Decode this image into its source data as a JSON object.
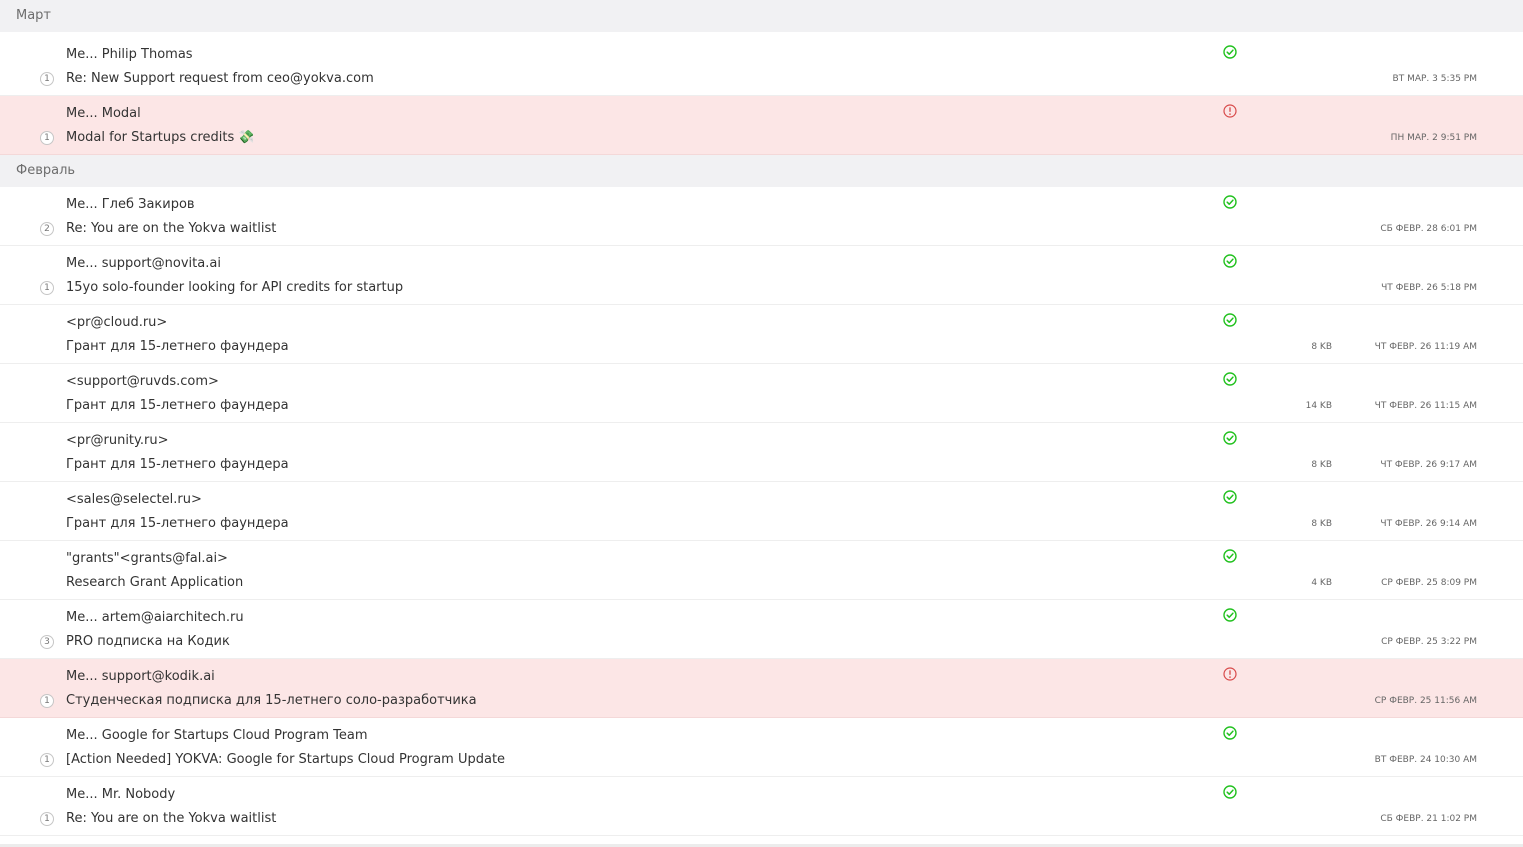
{
  "colors": {
    "ok": "#22c11f",
    "error": "#d84a4a",
    "error_row_bg": "#fce6e6",
    "group_bg": "#f1f1f3"
  },
  "groups": [
    {
      "label": "Март",
      "messages": [
        {
          "from": "Me... Philip Thomas",
          "subject": "Re: New Support request from ceo@yokva.com",
          "count": "1",
          "status": "check-circle-icon",
          "size": "",
          "date": "вт мар. 3 5:35 PM",
          "error": false
        },
        {
          "from": "Me... Modal",
          "subject": "Modal for Startups credits 💸",
          "count": "1",
          "status": "error-circle-icon",
          "size": "",
          "date": "пн мар. 2 9:51 PM",
          "error": true
        }
      ]
    },
    {
      "label": "Февраль",
      "messages": [
        {
          "from": "Me... Глеб Закиров",
          "subject": "Re: You are on the Yokva waitlist",
          "count": "2",
          "status": "check-circle-icon",
          "size": "",
          "date": "сб февр. 28 6:01 PM",
          "error": false
        },
        {
          "from": "Me... support@novita.ai",
          "subject": "15yo solo-founder looking for API credits for startup",
          "count": "1",
          "status": "check-circle-icon",
          "size": "",
          "date": "чт февр. 26 5:18 PM",
          "error": false
        },
        {
          "from": "<pr@cloud.ru>",
          "subject": "Грант для 15-летнего фаундера",
          "count": "",
          "status": "check-circle-icon",
          "size": "8 KB",
          "date": "чт февр. 26 11:19 AM",
          "error": false
        },
        {
          "from": "<support@ruvds.com>",
          "subject": "Грант для 15-летнего фаундера",
          "count": "",
          "status": "check-circle-icon",
          "size": "14 KB",
          "date": "чт февр. 26 11:15 AM",
          "error": false
        },
        {
          "from": "<pr@runity.ru>",
          "subject": "Грант для 15-летнего фаундера",
          "count": "",
          "status": "check-circle-icon",
          "size": "8 KB",
          "date": "чт февр. 26 9:17 AM",
          "error": false
        },
        {
          "from": "<sales@selectel.ru>",
          "subject": "Грант для 15-летнего фаундера",
          "count": "",
          "status": "check-circle-icon",
          "size": "8 KB",
          "date": "чт февр. 26 9:14 AM",
          "error": false
        },
        {
          "from": "\"grants\"<grants@fal.ai>",
          "subject": "Research Grant Application",
          "count": "",
          "status": "check-circle-icon",
          "size": "4 KB",
          "date": "ср февр. 25 8:09 PM",
          "error": false
        },
        {
          "from": "Me... artem@aiarchitech.ru",
          "subject": "PRO подписка на Кодик",
          "count": "3",
          "status": "check-circle-icon",
          "size": "",
          "date": "ср февр. 25 3:22 PM",
          "error": false
        },
        {
          "from": "Me... support@kodik.ai",
          "subject": "Студенческая подписка для 15-летнего соло-разработчика",
          "count": "1",
          "status": "error-circle-icon",
          "size": "",
          "date": "ср февр. 25 11:56 AM",
          "error": true
        },
        {
          "from": "Me... Google for Startups Cloud Program Team",
          "subject": "[Action Needed] YOKVA: Google for Startups Cloud Program Update",
          "count": "1",
          "status": "check-circle-icon",
          "size": "",
          "date": "вт февр. 24 10:30 AM",
          "error": false
        },
        {
          "from": "Me... Mr. Nobody",
          "subject": "Re: You are on the Yokva waitlist",
          "count": "1",
          "status": "check-circle-icon",
          "size": "",
          "date": "сб февр. 21 1:02 PM",
          "error": false
        }
      ]
    }
  ]
}
